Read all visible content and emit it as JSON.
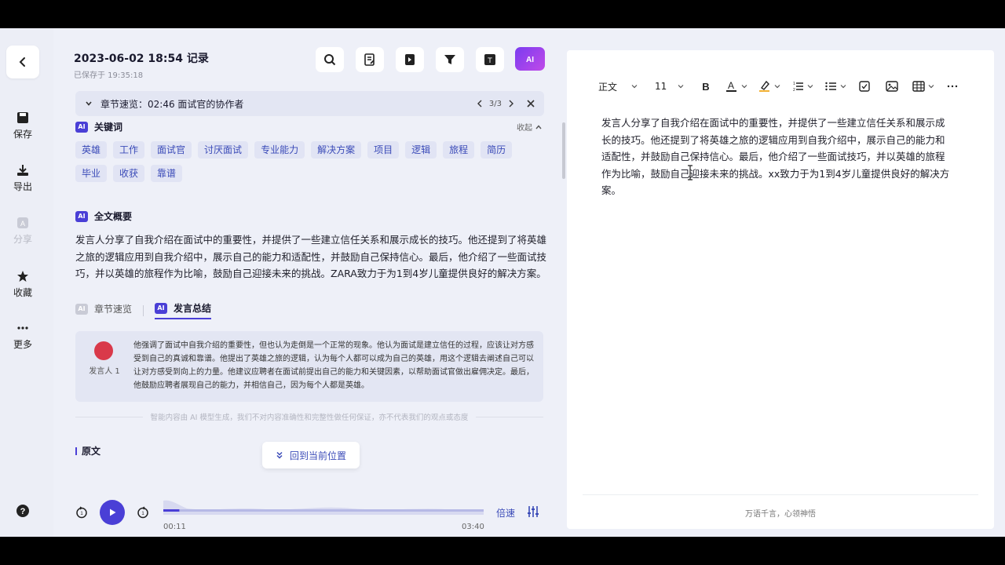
{
  "sidebar": {
    "items": [
      {
        "label": "保存",
        "icon": "save-icon"
      },
      {
        "label": "导出",
        "icon": "download-icon"
      },
      {
        "label": "分享",
        "icon": "share-icon"
      },
      {
        "label": "收藏",
        "icon": "star-icon"
      },
      {
        "label": "更多",
        "icon": "more-icon"
      }
    ]
  },
  "header": {
    "title": "2023-06-02 18:54 记录",
    "saved": "已保存于 19:35:18"
  },
  "chapter_bar": {
    "text": "章节速览：02:46 面试官的协作者",
    "page": "3/3"
  },
  "keywords": {
    "title": "关键词",
    "collapse": "收起",
    "tags": [
      "英雄",
      "工作",
      "面试官",
      "讨厌面试",
      "专业能力",
      "解决方案",
      "项目",
      "逻辑",
      "旅程",
      "简历",
      "毕业",
      "收获",
      "靠谱"
    ]
  },
  "summary": {
    "title": "全文概要",
    "text": "发言人分享了自我介绍在面试中的重要性，并提供了一些建立信任关系和展示成长的技巧。他还提到了将英雄之旅的逻辑应用到自我介绍中，展示自己的能力和适配性，并鼓励自己保持信心。最后，他介绍了一些面试技巧，并以英雄的旅程作为比喻，鼓励自己迎接未来的挑战。ZARA致力于为1到4岁儿童提供良好的解决方案。"
  },
  "tabs": {
    "chapters": "章节速览",
    "speech": "发言总结"
  },
  "speaker": {
    "name": "发言人 1",
    "text": "他强调了面试中自我介绍的重要性，但也认为走倒是一个正常的现象。他认为面试是建立信任的过程，应该让对方感受到自己的真诚和靠谱。他提出了英雄之旅的逻辑，认为每个人都可以成为自己的英雄，用这个逻辑去阐述自己可以让对方感受到向上的力量。他建议应聘者在面试前提出自己的能力和关键因素，以帮助面试官做出雇佣决定。最后，他鼓励应聘者展现自己的能力，并相信自己，因为每个人都是英雄。"
  },
  "disclaimer": "智能内容由 AI 模型生成，我们不对内容准确性和完整性做任何保证，亦不代表我们的观点或态度",
  "original": {
    "label": "原文",
    "back_to_current": "回到当前位置"
  },
  "player": {
    "current": "00:11",
    "total": "03:40",
    "speed": "倍速",
    "progress": 0.05
  },
  "editor": {
    "style": "正文",
    "font_size": "11",
    "text": "发言人分享了自我介绍在面试中的重要性，并提供了一些建立信任关系和展示成长的技巧。他还提到了将英雄之旅的逻辑应用到自我介绍中，展示自己的能力和适配性，并鼓励自己保持信心。最后，他介绍了一些面试技巧，并以英雄的旅程作为比喻，鼓励自己迎接未来的挑战。xx致力于为1到4岁儿童提供良好的解决方案。",
    "footer": "万语千言，心领神悟"
  },
  "colors": {
    "accent": "#4a3fd6",
    "tag_bg": "#e1e4f4",
    "tag_text": "#3b4bb8"
  }
}
